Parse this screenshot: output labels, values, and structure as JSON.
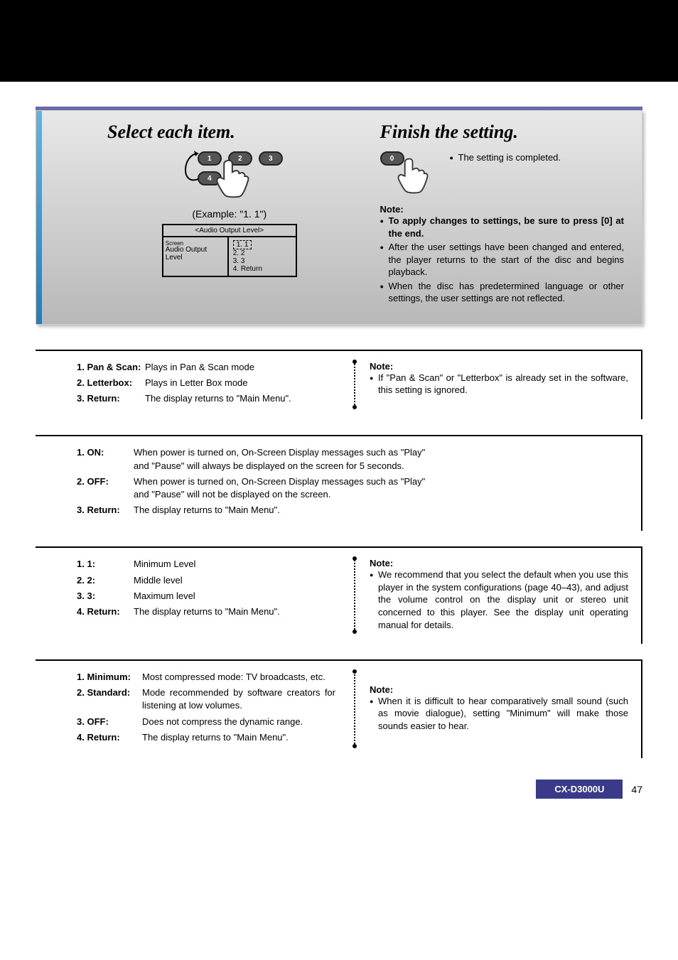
{
  "top": {
    "left_title": "Select each item.",
    "right_title": "Finish the setting.",
    "example": "(Example: \"1. 1\")",
    "buttons_left": [
      "1",
      "2",
      "3",
      "4"
    ],
    "button_right": "0",
    "finish_text": "The setting is completed.",
    "note_label": "Note:",
    "finish_bullets": [
      "To apply changes to settings, be sure to press [0] at the end.",
      "After the user settings have been changed and entered, the player returns to the start of the disc and begins playback.",
      "When the disc has predetermined language or other settings, the user settings are not reflected."
    ],
    "finish_bold_index": 0,
    "osd": {
      "title": "<Audio Output Level>",
      "left_items": [
        "Screen",
        "Audio Output Level"
      ],
      "left_trunc": "Screen",
      "right_items": [
        "1. 1",
        "2. 2",
        "3. 3",
        "4. Return"
      ],
      "selected_index": 0
    }
  },
  "sec1": {
    "opts": [
      {
        "k": "1. Pan & Scan",
        "d": "Plays in Pan & Scan mode"
      },
      {
        "k": "2. Letterbox",
        "d": "Plays in Letter Box mode"
      },
      {
        "k": "3. Return",
        "d": "The display returns to \"Main Menu\"."
      }
    ],
    "note_label": "Note:",
    "note_bullets": [
      "If \"Pan & Scan\" or \"Letterbox\" is already set in the software, this setting is ignored."
    ]
  },
  "sec2": {
    "opts": [
      {
        "k": "1. ON",
        "d": "When power is turned on, On-Screen Display messages such as \"Play\" and \"Pause\" will always be displayed on the screen for 5 seconds."
      },
      {
        "k": "2. OFF",
        "d": "When power is turned on, On-Screen Display messages such as \"Play\" and \"Pause\" will not be displayed on the screen."
      },
      {
        "k": "3. Return",
        "d": "The display returns to \"Main Menu\"."
      }
    ]
  },
  "sec3": {
    "opts": [
      {
        "k": "1. 1",
        "d": "Minimum Level"
      },
      {
        "k": "2. 2",
        "d": "Middle level"
      },
      {
        "k": "3. 3",
        "d": "Maximum level"
      },
      {
        "k": "4. Return",
        "d": "The display returns to \"Main Menu\"."
      }
    ],
    "note_label": "Note:",
    "note_bullets": [
      "We recommend that you select the default when you use this player in the system configurations (page 40–43), and adjust the volume control on the display unit or stereo unit concerned to this player. See the display unit operating manual for details."
    ]
  },
  "sec4": {
    "opts": [
      {
        "k": "1. Minimum",
        "d": "Most compressed mode: TV broadcasts, etc."
      },
      {
        "k": "2. Standard",
        "d": "Mode recommended by software creators for listening at low volumes."
      },
      {
        "k": "3. OFF",
        "d": "Does not compress the dynamic range."
      },
      {
        "k": "4. Return",
        "d": "The display returns to \"Main Menu\"."
      }
    ],
    "note_label": "Note:",
    "note_bullets": [
      "When it is difficult to hear comparatively small sound (such as movie dialogue), setting \"Minimum\" will make those sounds easier to hear."
    ]
  },
  "footer": {
    "model": "CX-D3000U",
    "page": "47"
  }
}
